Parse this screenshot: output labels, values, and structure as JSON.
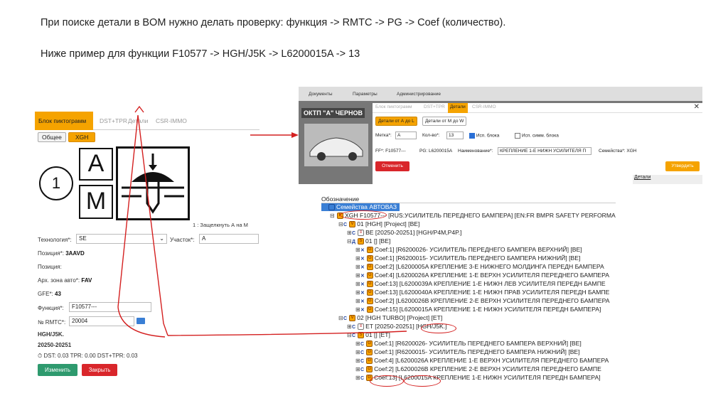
{
  "heading": {
    "line1": "При поиске детали в BOM нужно делать проверку: функция -> RMTC -> PG -> Coef (количество).",
    "line2": "Ниже пример для функции F10577 -> HGH/J5K -> L6200015A -> 13"
  },
  "left_panel": {
    "tabs": [
      "Блок пиктограмм",
      "DST+TPR",
      "Детали",
      "CSR-IMMO"
    ],
    "pills": [
      "Общее",
      "XGH"
    ],
    "picto": {
      "letter_a": "A",
      "letter_m": "M",
      "circle_num": "1"
    },
    "caption": "1 : Защелкнуть А на М",
    "tech_label": "Технология*:",
    "tech_value": "SE",
    "site_label": "Участок*:",
    "site_value": "A",
    "pos_label": "Позиция*:",
    "pos_value": "3AAVD",
    "pos2_label": "Позиция:",
    "zone_label": "Арх. зона авто*:",
    "zone_value": "FAV",
    "gfe_label": "GFE*:",
    "gfe_value": "43",
    "func_label": "Функция*:",
    "func_value": "F10577---",
    "rmtc_label": "№ RMTC*:",
    "rmtc_value": "20004",
    "code1": "HGH/J5K.",
    "code2": "20250-20251",
    "dst": "DST: 0.03 TPR: 0.00 DST+TPR: 0.03",
    "btn_edit": "Изменить",
    "btn_close": "Закрыть"
  },
  "right_window": {
    "menu": [
      "Документы",
      "Параметры",
      "Администрирование"
    ],
    "bg_title": "ОКТП \"А\" ЧЕРНОВ",
    "dtabs": [
      "Блок пиктограмм",
      "DST+TPR",
      "Детали",
      "CSR-IMMO"
    ],
    "close": "✕",
    "chip1": "Детали от А до L",
    "chip2": "Детали от М до W",
    "mark_label": "Метка*:",
    "mark_value": "A",
    "qty_label": "Кол-во*:",
    "qty_value": "13",
    "cb1": "Исп. блока",
    "cb2": "Исп. симм. блока",
    "ff": "FF*: F10577---",
    "pg": "PG: L6200015A",
    "name_label": "Наименование*:",
    "name_value": "КРЕПЛЕНИЕ 1-Е НИЖН УСИЛИТЕЛЯ П",
    "family": "Семейства*: XGH",
    "btn_cancel": "Отменить",
    "btn_ok": "Утвердить",
    "side_text": "Детали"
  },
  "tree": {
    "header": "Обозначение",
    "rows": [
      {
        "indent": 0,
        "pm": "",
        "icon": "blue",
        "tag": "",
        "text": "Семейства АВТОВАЗ"
      },
      {
        "indent": 1,
        "pm": "⊟",
        "icon": "F",
        "tag": "",
        "text": "XGH F10577--- [RUS:УСИЛИТЕЛЬ ПЕРЕДНЕГО БАМПЕРА] [EN:FR BMPR SAFETY PERFORMA"
      },
      {
        "indent": 2,
        "pm": "⊟",
        "icon": "V",
        "tag": "C",
        "text": "01 [HGH] [Project] [BE]"
      },
      {
        "indent": 3,
        "pm": "⊞",
        "icon": "doc",
        "tag": "C",
        "text": "BE [20250-20251] [HGH/P4M,P4P.]"
      },
      {
        "indent": 3,
        "pm": "⊟",
        "icon": "S",
        "tag": "Д",
        "text": "01 [] [BE]"
      },
      {
        "indent": 4,
        "pm": "⊞",
        "icon": "G",
        "tag": "✕",
        "text": "Coef:1] [R6200026- УСИЛИТЕЛЬ ПЕРЕДНЕГО БАМПЕРА ВЕРХНИЙ] [BE]"
      },
      {
        "indent": 4,
        "pm": "⊞",
        "icon": "G",
        "tag": "✕",
        "text": "Coef:1] [R6200015- УСИЛИТЕЛЬ ПЕРЕДНЕГО БАМПЕРА НИЖНИЙ] [BE]"
      },
      {
        "indent": 4,
        "pm": "⊞",
        "icon": "G",
        "tag": "✕",
        "text": "Coef:2] [L6200005A КРЕПЛЕНИЕ 3-Е НИЖНЕГО МОЛДИНГА ПЕРЕДН БАМПЕРА"
      },
      {
        "indent": 4,
        "pm": "⊞",
        "icon": "G",
        "tag": "✕",
        "text": "Coef:4] [L6200026A КРЕПЛЕНИЕ 1-Е ВЕРХН УСИЛИТЕЛЯ ПЕРЕДНЕГО БАМПЕРА"
      },
      {
        "indent": 4,
        "pm": "⊞",
        "icon": "G",
        "tag": "✕",
        "text": "Coef:13] [L6200039A КРЕПЛЕНИЕ 1-Е НИЖН ЛЕВ УСИЛИТЕЛЯ ПЕРЕДН БАМПЕ"
      },
      {
        "indent": 4,
        "pm": "⊞",
        "icon": "G",
        "tag": "✕",
        "text": "Coef:13] [L6200040A КРЕПЛЕНИЕ 1-Е НИЖН ПРАВ УСИЛИТЕЛЯ ПЕРЕДН БАМПЕ"
      },
      {
        "indent": 4,
        "pm": "⊞",
        "icon": "G",
        "tag": "✕",
        "text": "Coef:2] [L6200026B КРЕПЛЕНИЕ 2-Е ВЕРХН УСИЛИТЕЛЯ ПЕРЕДНЕГО БАМПЕРА"
      },
      {
        "indent": 4,
        "pm": "⊞",
        "icon": "G",
        "tag": "✕",
        "text": "Coef:15] [L6200015A КРЕПЛЕНИЕ 1-Е НИЖН УСИЛИТЕЛЯ ПЕРЕДН БАМПЕРА]"
      },
      {
        "indent": 2,
        "pm": "⊟",
        "icon": "V",
        "tag": "C",
        "text": "02 [HGH TURBO] [Project] [ET]"
      },
      {
        "indent": 3,
        "pm": "⊞",
        "icon": "doc",
        "tag": "C",
        "text": "ET [20250-20251] [HGH/J5K.]"
      },
      {
        "indent": 3,
        "pm": "⊟",
        "icon": "S",
        "tag": "C",
        "text": "01 [] [ET]"
      },
      {
        "indent": 4,
        "pm": "⊞",
        "icon": "G",
        "tag": "C",
        "text": "Coef:1] [R6200026- УСИЛИТЕЛЬ ПЕРЕДНЕГО БАМПЕРА ВЕРХНИЙ] [BE]"
      },
      {
        "indent": 4,
        "pm": "⊞",
        "icon": "G",
        "tag": "C",
        "text": "Coef:1] [R6200015- УСИЛИТЕЛЬ ПЕРЕДНЕГО БАМПЕРА НИЖНИЙ] [BE]"
      },
      {
        "indent": 4,
        "pm": "⊞",
        "icon": "G",
        "tag": "C",
        "text": "Coef:4] [L6200026A КРЕПЛЕНИЕ 1-Е ВЕРХН УСИЛИТЕЛЯ ПЕРЕДНЕГО БАМПЕРА"
      },
      {
        "indent": 4,
        "pm": "⊞",
        "icon": "G",
        "tag": "C",
        "text": "Coef:2] [L6200026B КРЕПЛЕНИЕ 2-Е ВЕРХН УСИЛИТЕЛЯ ПЕРЕДНЕГО БАМПЕ"
      },
      {
        "indent": 4,
        "pm": "⊞",
        "icon": "G",
        "tag": "C",
        "text": "Coef:13] [L6200015A КРЕПЛЕНИЕ 1-Е НИЖН УСИЛИТЕЛЯ ПЕРЕДН БАМПЕРА]"
      }
    ]
  },
  "colors": {
    "accent": "#f5a300",
    "green": "#2e9a6e",
    "red": "#d9262b",
    "annotation": "#d42020"
  }
}
